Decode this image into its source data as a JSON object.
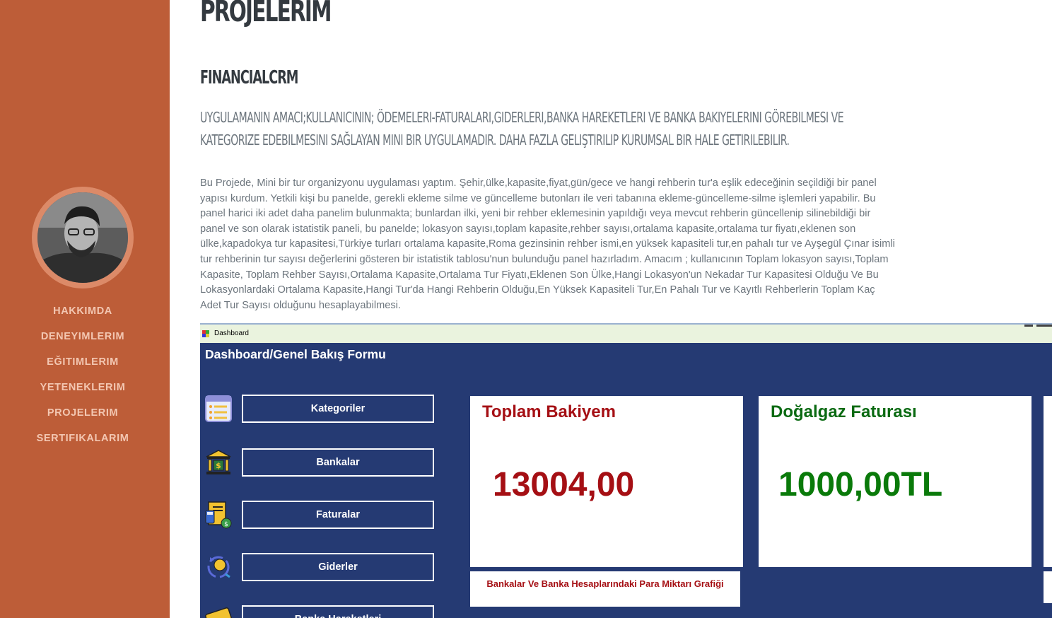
{
  "sidebar": {
    "nav": [
      "HAKKIMDA",
      "DENEYIMLERIM",
      "EĞITIMLERIM",
      "YETENEKLERIM",
      "PROJELERIM",
      "SERTIFIKALARIM"
    ]
  },
  "main": {
    "page_title": "PROJELERIM",
    "project_title": "FINANCIALCRM",
    "subtitle": "UYGULAMANIN AMACI;KULLANICININ; ÖDEMELERI-FATURALARI,GIDERLERI,BANKA HAREKETLERI VE BANKA BAKIYELERINI GÖREBILMESI VE KATEGORIZE EDEBILMESINI SAĞLAYAN MINI BIR UYGULAMADIR. DAHA FAZLA GELIŞTIRILIP KURUMSAL BIR HALE GETIRILEBILIR.",
    "description": "Bu Projede, Mini bir tur organizyonu uygulaması yaptım. Şehir,ülke,kapasite,fiyat,gün/gece ve hangi rehberin tur'a eşlik edeceğinin seçildiği bir panel yapısı kurdum. Yetkili kişi bu panelde, gerekli ekleme silme ve güncelleme butonları ile veri tabanına ekleme-güncelleme-silme işlemleri yapabilir. Bu panel harici iki adet daha panelim bulunmakta; bunlardan ilki, yeni bir rehber eklemesinin yapıldığı veya mevcut rehberin güncellenip silinebildiği bir panel ve son olarak istatistik paneli, bu panelde; lokasyon sayısı,toplam kapasite,rehber sayısı,ortalama kapasite,ortalama tur fiyatı,eklenen son ülke,kapadokya tur kapasitesi,Türkiye turları ortalama kapasite,Roma gezinsinin rehber ismi,en yüksek kapasiteli tur,en pahalı tur ve Ayşegül Çınar isimli tur rehberinin tur sayısı değerlerini gösteren bir istatistik tablosu'nun bulunduğu panel hazırladım. Amacım ; kullanıcının Toplam lokasyon sayısı,Toplam Kapasite, Toplam Rehber Sayısı,Ortalama Kapasite,Ortalama Tur Fiyatı,Eklenen Son Ülke,Hangi Lokasyon'un Nekadar Tur Kapasitesi Olduğu Ve Bu Lokasyonlardaki Ortalama Kapasite,Hangi Tur'da Hangi Rehberin Olduğu,En Yüksek Kapasiteli Tur,En Pahalı Tur ve Kayıtlı Rehberlerin Toplam Kaç Adet Tur Sayısı olduğunu hesaplayabilmesi."
  },
  "screenshot": {
    "window_title": "Dashboard",
    "form_title": "Dashboard/Genel Bakış Formu",
    "menu": [
      {
        "label": "Kategoriler",
        "icon": "category-list-icon"
      },
      {
        "label": "Bankalar",
        "icon": "bank-icon"
      },
      {
        "label": "Faturalar",
        "icon": "invoice-icon"
      },
      {
        "label": "Giderler",
        "icon": "expense-icon"
      },
      {
        "label": "Banka Hareketleri",
        "icon": "credit-card-icon"
      }
    ],
    "cards": [
      {
        "title": "Toplam Bakiyem",
        "value": "13004,00",
        "color": "#a50f14"
      },
      {
        "title": "Doğalgaz Faturası",
        "value": "1000,00TL",
        "color": "#0a7a0a"
      }
    ],
    "chart_caption": "Bankalar Ve Banka Hesaplarındaki Para Miktarı Grafiği"
  },
  "colors": {
    "sidebar": "#bd5d38",
    "nav_text": "#f3c7b2",
    "dashboard_bg": "#253a73",
    "heading": "#343a40",
    "body_text": "#6c757d"
  }
}
